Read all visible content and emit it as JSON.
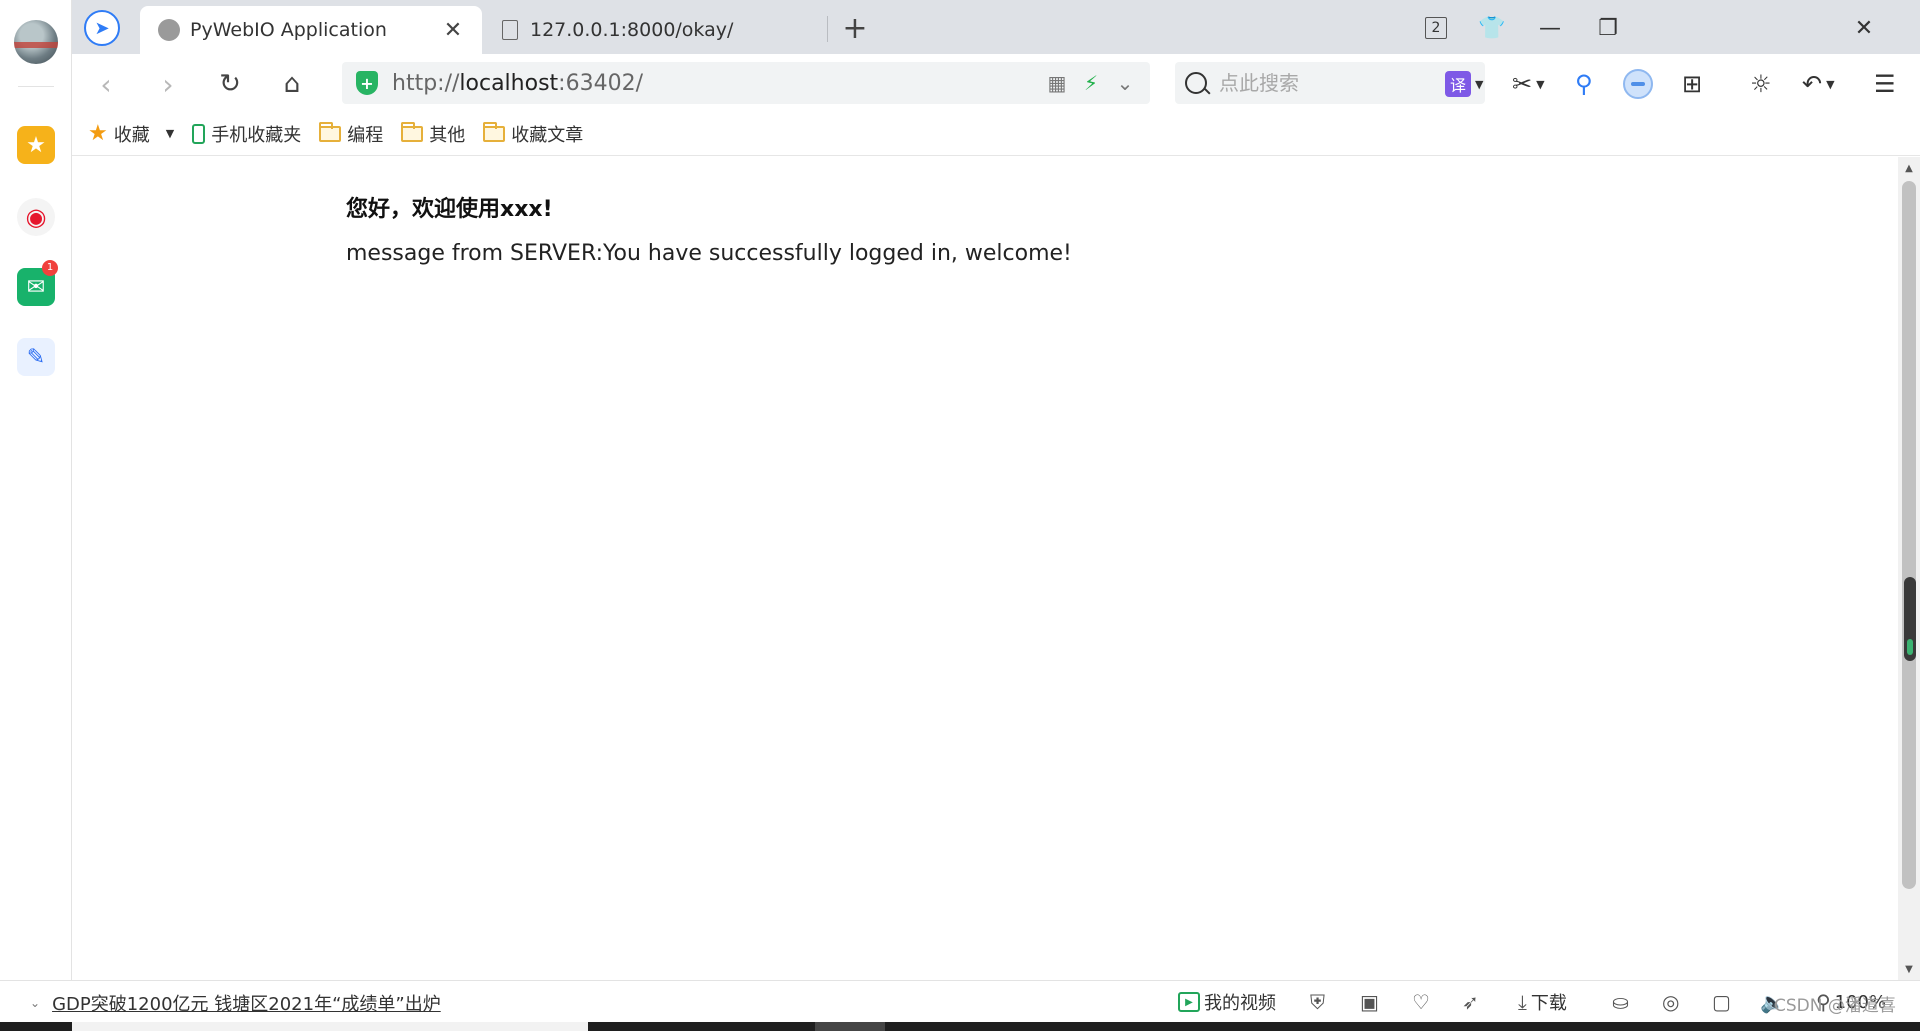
{
  "sidebar": {
    "items": [
      "avatar",
      "favorites-icon",
      "weibo-icon",
      "mail-icon",
      "notes-icon"
    ],
    "mail_badge": "1"
  },
  "tabs": [
    {
      "title": "PyWebIO Application",
      "active": true
    },
    {
      "title": "127.0.0.1:8000/okay/",
      "active": false
    }
  ],
  "window": {
    "tab_count": "2"
  },
  "toolbar": {
    "url_scheme": "http://",
    "url_host": "localhost",
    "url_rest": ":63402/",
    "search_placeholder": "点此搜索",
    "translate_label": "译"
  },
  "bookmarks": {
    "fav_label": "收藏",
    "items": [
      "手机收藏夹",
      "编程",
      "其他",
      "收藏文章"
    ]
  },
  "page": {
    "greeting": "您好，欢迎使用xxx!",
    "message": "message from SERVER:You have successfully logged in, welcome!"
  },
  "status": {
    "news": "GDP突破1200亿元 钱塘区2021年“成绩单”出炉",
    "my_videos": "我的视频",
    "download": "下载",
    "zoom": "100%",
    "watermark": "CSDN @潘道喜"
  },
  "colors": {
    "accent": "#2f7cf6",
    "secure": "#28b463",
    "tabstrip": "#dee1e6"
  }
}
